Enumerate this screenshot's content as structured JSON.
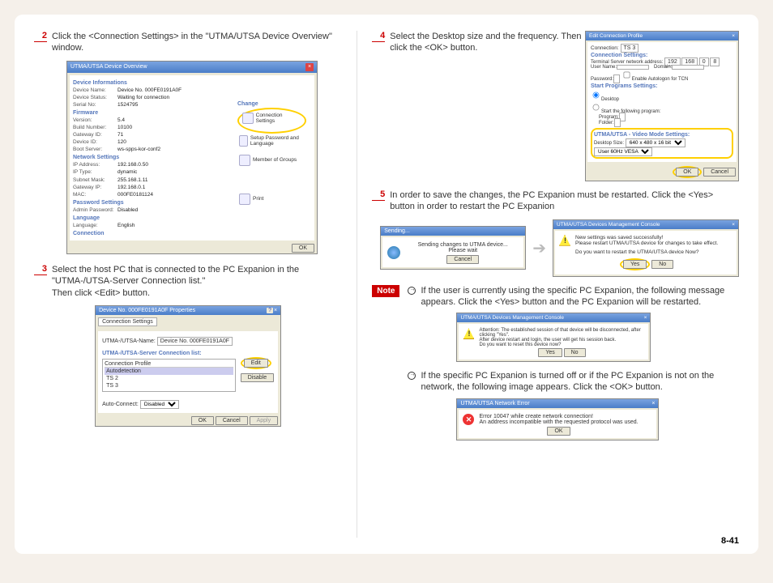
{
  "page_number": "8-41",
  "steps": {
    "s2": {
      "num": "2",
      "text": "Click the <Connection Settings> in the \"UTMA/UTSA Device Overview\" window."
    },
    "s3": {
      "num": "3",
      "text": "Select the host PC that is connected to the PC Expanion in the \"UTMA-/UTSA-Server Connection list.\"\nThen click <Edit> button."
    },
    "s4": {
      "num": "4",
      "text": "Select the Desktop size and the frequency. Then click the <OK> button."
    },
    "s5": {
      "num": "5",
      "text": "In order to save the changes, the PC Expanion must be restarted. Click the <Yes> button in order to restart the PC Expanion"
    }
  },
  "overview": {
    "title": "UTMA/UTSA Device Overview",
    "sections": {
      "device_info": "Device Informations",
      "firmware": "Firmware",
      "network": "Network Settings",
      "password": "Password Settings",
      "language": "Language",
      "connection": "Connection"
    },
    "rows": {
      "device_name": "Device Name:",
      "device_name_v": "Device No. 000FE0191A0F",
      "device_status": "Device Status:",
      "device_status_v": "Waiting for connection",
      "serial_no": "Serial No:",
      "serial_no_v": "1524795",
      "version": "Version:",
      "version_v": "5.4",
      "build": "Build Number:",
      "build_v": "10100",
      "gateway_id": "Gateway ID:",
      "gateway_id_v": "71",
      "device_id": "Device ID:",
      "device_id_v": "120",
      "boot_server": "Boot Server:",
      "boot_server_v": "ws-spps-kor-conf2",
      "ip_addr": "IP Address:",
      "ip_addr_v": "192.168.0.50",
      "ip_type": "IP Type:",
      "ip_type_v": "dynamic",
      "subnet": "Subnet Mask:",
      "subnet_v": "255.168.1.11",
      "gateway_ip": "Gateway IP:",
      "gateway_ip_v": "192.168.0.1",
      "mac": "MAC:",
      "mac_v": "000FE0181124",
      "admin_pw": "Admin Password:",
      "admin_pw_v": "Disabled",
      "lang": "Language:",
      "lang_v": "English"
    },
    "panel": {
      "change": "Change",
      "conn_settings": "Connection Settings",
      "setup_pw": "Setup Password and Language",
      "member": "Member of Groups",
      "print": "Print"
    },
    "ok": "OK"
  },
  "props": {
    "title": "Device No. 000FE0191A0F Properties",
    "tab": "Connection Settings",
    "name_label": "UTMA-/UTSA-Name:",
    "name_value": "Device No. 000FE0191A0F",
    "list_label": "UTMA-/UTSA-Server Connection list:",
    "conn_profile": "Connection Profile",
    "items": {
      "auto": "Autodetection",
      "ts2": "TS 2",
      "ts3": "TS 3"
    },
    "edit": "Edit",
    "disable": "Disable",
    "auto_connect": "Auto-Connect:",
    "auto_connect_v": "Disabled",
    "ok": "OK",
    "cancel": "Cancel",
    "apply": "Apply"
  },
  "edit_profile": {
    "title": "Edit Connection Profile",
    "conn_label": "Connection:",
    "conn_value": "TS 3",
    "section_conn": "Connection Settings:",
    "tcs_label": "Terminal Server network address:",
    "ip1": "192",
    "ip2": "168",
    "ip3": "0",
    "ip4": "8",
    "user_label": "User Name:",
    "domain_label": "Domain:",
    "pw_label": "Password:",
    "auto_login": "Enable Autologon for TCN",
    "section_start": "Start Programs Settings:",
    "desktop_opt": "Desktop",
    "start_prog_opt": "Start the following program:",
    "program_label": "Program:",
    "folder_label": "Folder:",
    "section_video": "UTMA/UTSA - Video Mode Settings:",
    "desktop_size_label": "Desktop Size:",
    "desktop_size_value": "640 x 480 x 16 bit",
    "freq_value": "User 60Hz VESA",
    "ok": "OK",
    "cancel": "Cancel"
  },
  "sending": {
    "title": "Sending...",
    "msg1": "Sending changes to UTMA device...",
    "msg2": "Please wait",
    "cancel": "Cancel"
  },
  "restart_prompt": {
    "title": "UTMA/UTSA Devices Management Console",
    "line1": "New settings was saved successfully!",
    "line2": "Please restart UTMA/UTSA device for changes to take effect.",
    "line3": "Do you want to restart the UTMA/UTSA device Now?",
    "yes": "Yes",
    "no": "No"
  },
  "note": {
    "label": "Note",
    "bullet1": "If the user is currently using the specific PC Expanion, the following message appears. Click the <Yes> button and the PC Expanion will be restarted.",
    "bullet2": "If the specific PC Expanion is turned off or if the PC Expanion is not on the network, the following image appears. Click the <OK> button."
  },
  "attention": {
    "title": "UTMA/UTSA Devices Management Console",
    "msg": "Attention: The established session of that device will be disconnected, after clicking \"Yes\".\nAfter device restart and login, the user will get his session back.\nDo you want to reset this device now?",
    "yes": "Yes",
    "no": "No"
  },
  "net_error": {
    "title": "UTMA/UTSA Network Error",
    "line1": "Error 10047 while create network connection!",
    "line2": "An address incompatible with the requested protocol was used.",
    "ok": "OK"
  }
}
